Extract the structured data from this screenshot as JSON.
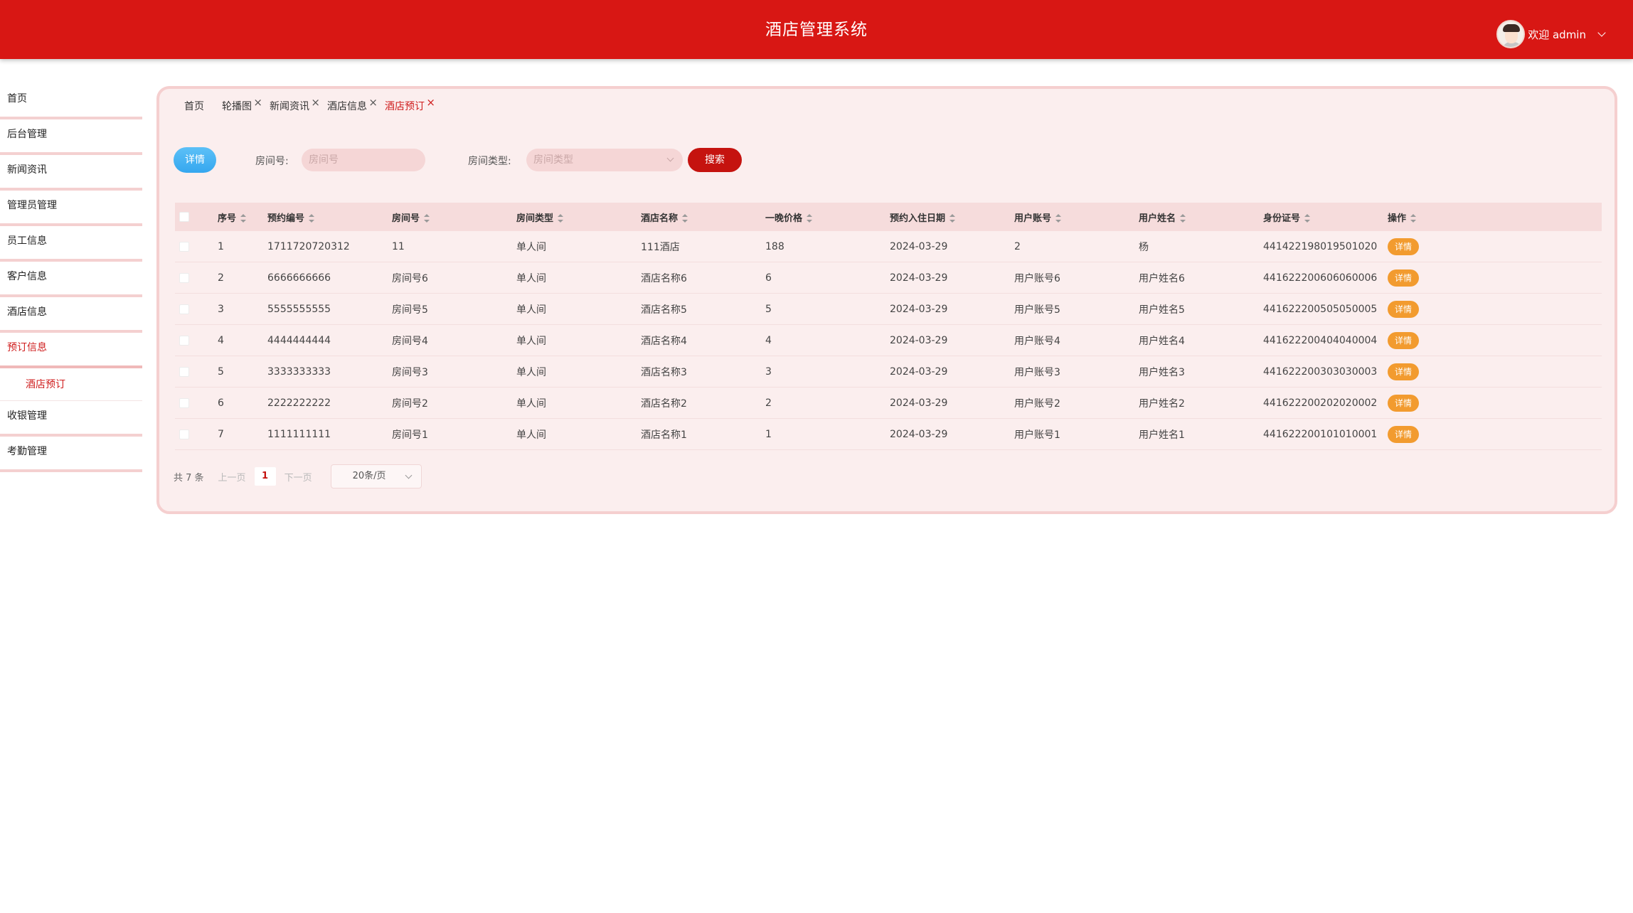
{
  "header": {
    "title": "酒店管理系统",
    "user_text": "欢迎 admin"
  },
  "sidebar": {
    "items": [
      {
        "label": "首页"
      },
      {
        "label": "后台管理"
      },
      {
        "label": "新闻资讯"
      },
      {
        "label": "管理员管理"
      },
      {
        "label": "员工信息"
      },
      {
        "label": "客户信息"
      },
      {
        "label": "酒店信息"
      },
      {
        "label": "预订信息"
      },
      {
        "label": "收银管理"
      },
      {
        "label": "考勤管理"
      }
    ],
    "submenu": {
      "label": "酒店预订"
    }
  },
  "tabs": [
    {
      "label": "首页"
    },
    {
      "label": "轮播图"
    },
    {
      "label": "新闻资讯"
    },
    {
      "label": "酒店信息"
    },
    {
      "label": "酒店预订"
    }
  ],
  "toolbar": {
    "detail_label": "详情",
    "room_no_label": "房间号:",
    "room_no_placeholder": "房间号",
    "room_type_label": "房间类型:",
    "room_type_placeholder": "房间类型",
    "search_label": "搜索"
  },
  "table": {
    "columns": [
      "序号",
      "预约编号",
      "房间号",
      "房间类型",
      "酒店名称",
      "一晚价格",
      "预约入住日期",
      "用户账号",
      "用户姓名",
      "身份证号",
      "操作"
    ],
    "action_label": "详情",
    "rows": [
      [
        "1",
        "1711720720312",
        "11",
        "单人间",
        "111酒店",
        "188",
        "2024-03-29",
        "2",
        "杨",
        "441422198019501020"
      ],
      [
        "2",
        "6666666666",
        "房间号6",
        "单人间",
        "酒店名称6",
        "6",
        "2024-03-29",
        "用户账号6",
        "用户姓名6",
        "441622200606060006"
      ],
      [
        "3",
        "5555555555",
        "房间号5",
        "单人间",
        "酒店名称5",
        "5",
        "2024-03-29",
        "用户账号5",
        "用户姓名5",
        "441622200505050005"
      ],
      [
        "4",
        "4444444444",
        "房间号4",
        "单人间",
        "酒店名称4",
        "4",
        "2024-03-29",
        "用户账号4",
        "用户姓名4",
        "441622200404040004"
      ],
      [
        "5",
        "3333333333",
        "房间号3",
        "单人间",
        "酒店名称3",
        "3",
        "2024-03-29",
        "用户账号3",
        "用户姓名3",
        "441622200303030003"
      ],
      [
        "6",
        "2222222222",
        "房间号2",
        "单人间",
        "酒店名称2",
        "2",
        "2024-03-29",
        "用户账号2",
        "用户姓名2",
        "441622200202020002"
      ],
      [
        "7",
        "1111111111",
        "房间号1",
        "单人间",
        "酒店名称1",
        "1",
        "2024-03-29",
        "用户账号1",
        "用户姓名1",
        "441622200101010001"
      ]
    ]
  },
  "pagination": {
    "total": "共 7 条",
    "prev": "上一页",
    "page": "1",
    "next": "下一页",
    "page_size": "20条/页"
  }
}
